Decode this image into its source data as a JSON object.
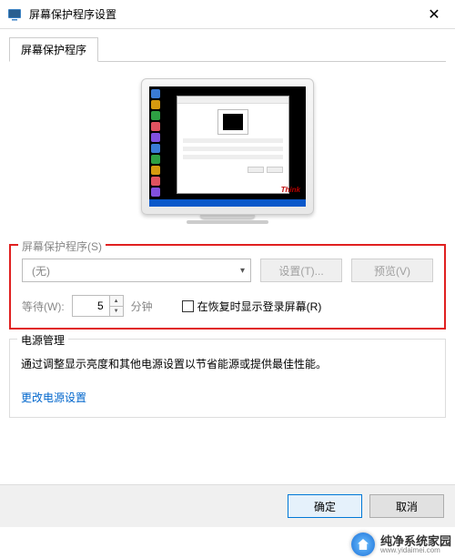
{
  "window": {
    "title": "屏幕保护程序设置",
    "close_glyph": "✕"
  },
  "tab": {
    "label": "屏幕保护程序"
  },
  "preview": {
    "brand_text": "Think"
  },
  "screensaver_group": {
    "legend": "屏幕保护程序(S)",
    "combo_value": "(无)",
    "settings_btn": "设置(T)...",
    "preview_btn": "预览(V)",
    "wait_label": "等待(W):",
    "wait_value": "5",
    "wait_unit": "分钟",
    "resume_checkbox_label": "在恢复时显示登录屏幕(R)",
    "resume_checked": false
  },
  "power_group": {
    "legend": "电源管理",
    "description": "通过调整显示亮度和其他电源设置以节省能源或提供最佳性能。",
    "link_text": "更改电源设置"
  },
  "buttons": {
    "ok": "确定",
    "cancel": "取消"
  },
  "watermark": {
    "name": "纯净系统家园",
    "url": "www.yidaimei.com"
  }
}
